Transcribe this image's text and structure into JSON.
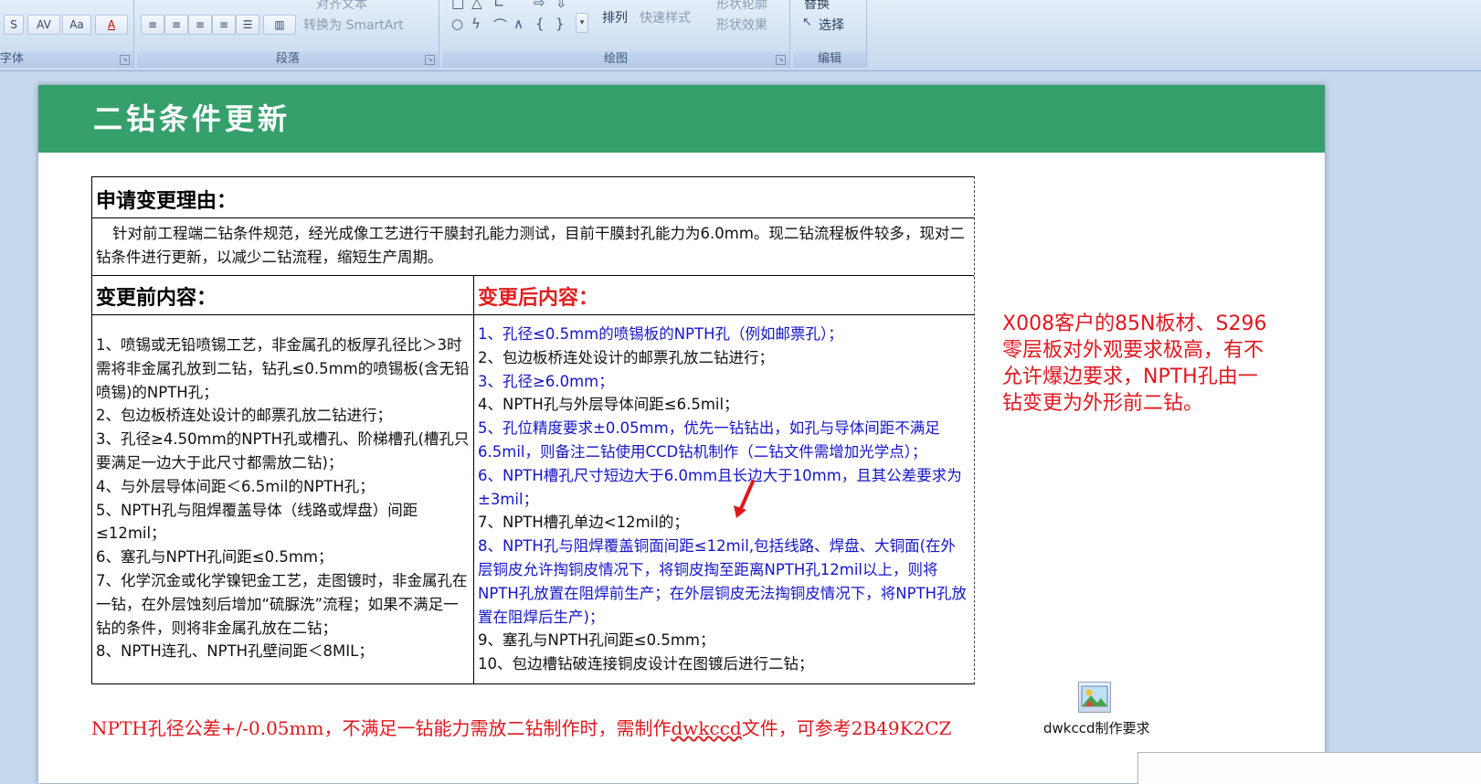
{
  "ribbon": {
    "groups": {
      "font": "字体",
      "paragraph": "段落",
      "drawing": "绘图",
      "edit": "编辑"
    },
    "font_buttons": [
      "S",
      "AV",
      "Aa",
      "A"
    ],
    "align_text": "对齐文本",
    "smartart": "转换为 SmartArt",
    "arrange": "排列",
    "quick_styles": "快速样式",
    "shape_outline": "形状轮廓",
    "shape_effects": "形状效果",
    "replace": "替换",
    "select": "选择"
  },
  "slide": {
    "title": "二钻条件更新",
    "reason_heading": "申请变更理由：",
    "reason_text": "针对前工程端二钻条件规范，经光成像工艺进行干膜封孔能力测试，目前干膜封孔能力为6.0mm。现二钻流程板件较多，现对二钻条件进行更新，以减少二钻流程，缩短生产周期。",
    "before_heading": "变更前内容：",
    "after_heading": "变更后内容：",
    "before_items": [
      "1、喷锡或无铅喷锡工艺，非金属孔的板厚孔径比＞3时需将非金属孔放到二钻，钻孔≤0.5mm的喷锡板(含无铅喷锡)的NPTH孔；",
      "2、包边板桥连处设计的邮票孔放二钻进行；",
      "3、孔径≥4.50mm的NPTH孔或槽孔、阶梯槽孔(槽孔只要满足一边大于此尺寸都需放二钻)；",
      "4、与外层导体间距＜6.5mil的NPTH孔；",
      "5、NPTH孔与阻焊覆盖导体（线路或焊盘）间距≤12mil；",
      "6、塞孔与NPTH孔间距≤0.5mm；",
      "7、化学沉金或化学镍钯金工艺，走图镀时，非金属孔在一钻，在外层蚀刻后增加“硫脲洗”流程；如果不满足一钻的条件，则将非金属孔放在二钻；",
      "8、NPTH连孔、NPTH孔壁间距＜8MIL；"
    ],
    "after_items": [
      "1、孔径≤0.5mm的喷锡板的NPTH孔（例如邮票孔）；",
      "2、包边板桥连处设计的邮票孔放二钻进行；",
      "3、孔径≥6.0mm；",
      "4、NPTH孔与外层导体间距≤6.5mil；",
      "5、孔位精度要求±0.05mm，优先一钻钻出，如孔与导体间距不满足6.5mil，则备注二钻使用CCD钻机制作（二钻文件需增加光学点）；",
      "6、NPTH槽孔尺寸短边大于6.0mm且长边大于10mm，且其公差要求为±3mil；",
      "7、NPTH槽孔单边<12mil的；",
      "8、NPTH孔与阻焊覆盖铜面间距≤12mil,包括线路、焊盘、大铜面(在外层铜皮允许掏铜皮情况下，将铜皮掏至距离NPTH孔12mil以上，则将NPTH孔放置在阻焊前生产；在外层铜皮无法掏铜皮情况下，将NPTH孔放置在阻焊后生产)；",
      "9、塞孔与NPTH孔间距≤0.5mm；",
      "10、包边槽钻破连接铜皮设计在图镀后进行二钻；"
    ],
    "after_colors": [
      "blue",
      "black",
      "blue",
      "black",
      "blue",
      "blue",
      "black",
      "blue",
      "black",
      "black"
    ],
    "side_note": "X008客户的85N板材、S296零层板对外观要求极高，有不允许爆边要求，NPTH孔由一钻变更为外形前二钻。",
    "bottom_note_a": "NPTH孔径公差+/-0.05mm，不满足一钻能力需放二钻制作时，需制作",
    "bottom_note_link": "dwkccd",
    "bottom_note_b": "文件，可参考2B49K2CZ",
    "attachment_caption": "dwkccd制作要求"
  },
  "colors": {
    "header_green": "#35a06b",
    "note_red": "#e0171e",
    "item_blue": "#1515c8"
  }
}
